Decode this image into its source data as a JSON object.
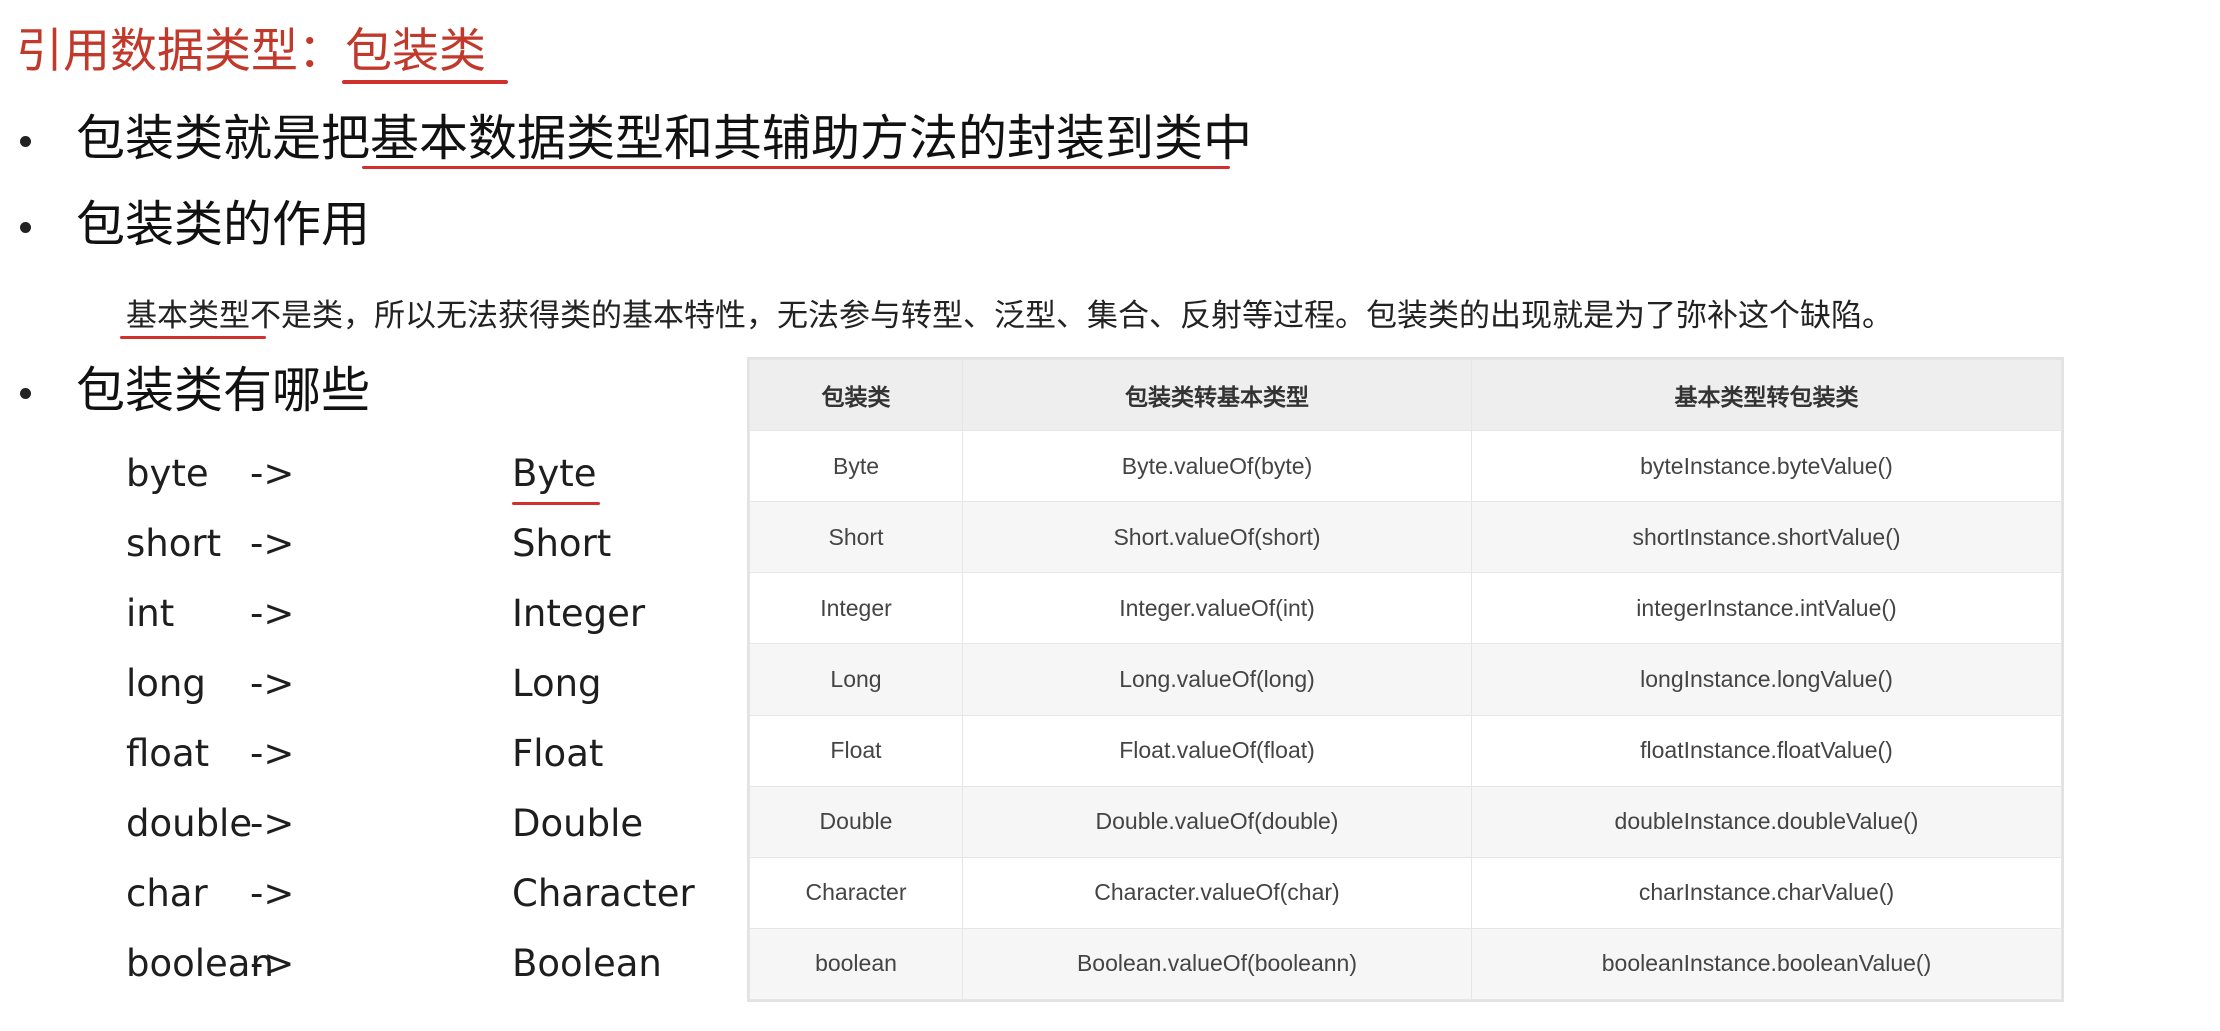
{
  "title": "引用数据类型：包装类",
  "bullets": {
    "b1": "包装类就是把基本数据类型和其辅助方法的封装到类中",
    "b2": "包装类的作用",
    "b3": "包装类有哪些"
  },
  "description": "基本类型不是类，所以无法获得类的基本特性，无法参与转型、泛型、集合、反射等过程。包装类的出现就是为了弥补这个缺陷。",
  "mapping": [
    {
      "primitive": "byte",
      "arrow": "->",
      "wrapper": "Byte"
    },
    {
      "primitive": "short",
      "arrow": "->",
      "wrapper": "Short"
    },
    {
      "primitive": "int",
      "arrow": "->",
      "wrapper": "Integer"
    },
    {
      "primitive": "long",
      "arrow": "->",
      "wrapper": "Long"
    },
    {
      "primitive": "float",
      "arrow": "->",
      "wrapper": "Float"
    },
    {
      "primitive": "double",
      "arrow": "->",
      "wrapper": "Double"
    },
    {
      "primitive": "char",
      "arrow": "->",
      "wrapper": "Character"
    },
    {
      "primitive": "boolean",
      "arrow": "->",
      "wrapper": "Boolean"
    }
  ],
  "table": {
    "headers": [
      "包装类",
      "包装类转基本类型",
      "基本类型转包装类"
    ],
    "rows": [
      [
        "Byte",
        "Byte.valueOf(byte)",
        "byteInstance.byteValue()"
      ],
      [
        "Short",
        "Short.valueOf(short)",
        "shortInstance.shortValue()"
      ],
      [
        "Integer",
        "Integer.valueOf(int)",
        "integerInstance.intValue()"
      ],
      [
        "Long",
        "Long.valueOf(long)",
        "longInstance.longValue()"
      ],
      [
        "Float",
        "Float.valueOf(float)",
        "floatInstance.floatValue()"
      ],
      [
        "Double",
        "Double.valueOf(double)",
        "doubleInstance.doubleValue()"
      ],
      [
        "Character",
        "Character.valueOf(char)",
        "charInstance.charValue()"
      ],
      [
        "boolean",
        "Boolean.valueOf(booleann)",
        "booleanInstance.booleanValue()"
      ]
    ]
  },
  "colors": {
    "title": "#c0392b",
    "underline": "#d0312d",
    "table_header_bg": "#eeeeee",
    "table_stripe_bg": "#f6f6f6"
  }
}
